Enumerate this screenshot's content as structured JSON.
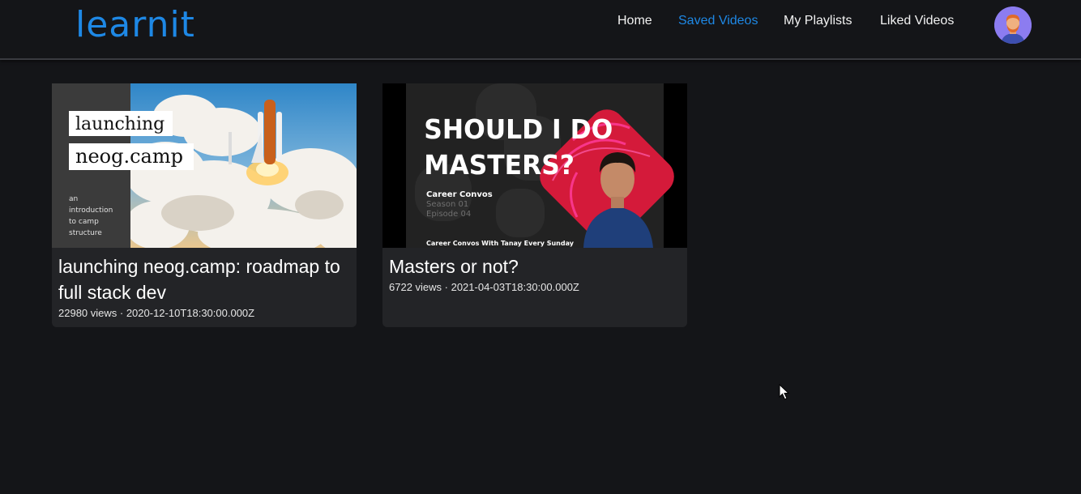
{
  "header": {
    "logo": "learnit",
    "nav": [
      {
        "label": "Home",
        "active": false
      },
      {
        "label": "Saved Videos",
        "active": true
      },
      {
        "label": "My Playlists",
        "active": false
      },
      {
        "label": "Liked Videos",
        "active": false
      }
    ],
    "avatar_icon": "user-avatar-icon"
  },
  "videos": [
    {
      "title": "launching neog.camp: roadmap to full stack dev",
      "meta": "22980 views · 2020-12-10T18:30:00.000Z",
      "thumbnail": {
        "line1": "launching",
        "line2": "neog.camp",
        "caption": [
          "an",
          "introduction",
          "to camp",
          "structure"
        ]
      }
    },
    {
      "title": "Masters or not?",
      "meta": "6722 views · 2021-04-03T18:30:00.000Z",
      "thumbnail": {
        "headline1": "SHOULD I DO",
        "headline2": "MASTERS?",
        "series": "Career Convos",
        "season": "Season 01",
        "episode": "Episode 04",
        "footer": "Career Convos With Tanay Every Sunday"
      }
    }
  ],
  "colors": {
    "background": "#141518",
    "card": "#232427",
    "accent": "#1e88e5",
    "avatar_bg": "#8c7cf0"
  }
}
